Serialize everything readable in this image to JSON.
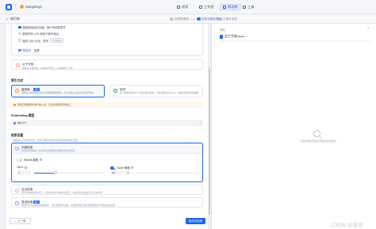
{
  "topbar": {
    "workspace_name": "Songming...",
    "nav": [
      {
        "label": "探索"
      },
      {
        "label": "工作室"
      },
      {
        "label": "知识库"
      },
      {
        "label": "工具"
      }
    ]
  },
  "steps": {
    "back_label": "知识库",
    "items": [
      {
        "num": "1",
        "label": "选择数据源"
      },
      {
        "num": "2",
        "label": "文本分段与清洗"
      },
      {
        "num": "3",
        "label": "处理并完成"
      }
    ]
  },
  "source": {
    "line1": "替换掉连续的空格、换行符和制表符",
    "line2": "删除所有 URL 和电子邮件地址",
    "line3": "使用 Q&A 分段，语言",
    "line3_tag": "Chinese",
    "preview": "预览块",
    "reset": "重置"
  },
  "parent_child": {
    "title": "父子分段",
    "desc": "使用父子模式时，子块用于检索，父块用作上下文"
  },
  "index_mode": {
    "section": "索引方式",
    "high": {
      "title": "高质量",
      "badge": "推荐",
      "desc": "调用嵌入模型处理文档以实现更精确的检索，可以帮助LLM生成高质量的答案"
    },
    "eco": {
      "title": "经济",
      "desc": "每个数据块使用10个关键词进行检索，不会消耗任何tokens，但会降低检索的准确性"
    }
  },
  "warning": "使用高质量模式进行嵌入后，无法切换回经济模式。",
  "embedding": {
    "section": "Embedding 模型",
    "value": "bge-m3"
  },
  "retrieval": {
    "section": "检索设置",
    "subtitle": "了解更多关于检索方法，您可以随时在知识库设置中更改此设置。",
    "vector": {
      "title": "向量检索",
      "desc": "通过生成查询嵌入并查询与其向量表示最相似的文本分段"
    },
    "rerank_label": "Rerank 模型",
    "topk_label": "Top K",
    "topk_value": "3",
    "topk_fraction": 0.3,
    "score_label": "Score 阈值",
    "score_value": "0.5",
    "score_fraction": 0.0,
    "fulltext": {
      "title": "全文检索",
      "desc": "索引文档中的所有词汇，从而允许用户查询任意词汇，并返回包含这些词汇的文本片段"
    },
    "hybrid": {
      "title": "混合检索",
      "badge": "推荐",
      "desc": "同时执行全文检索和向量检索，并应用重排序步骤，从两类查询结果中选择匹配用户问题的最佳结果"
    }
  },
  "footer": {
    "prev": "上一步",
    "save": "保存并处理"
  },
  "preview_panel": {
    "title": "预览",
    "file_name": "员工手册.docx",
    "empty_text": "点击左侧的\"预览块\"按钮来加载预览"
  },
  "watermark": "CSDN @爱萌",
  "colors": {
    "accent": "#1c64f2",
    "warning": "#f79009"
  }
}
